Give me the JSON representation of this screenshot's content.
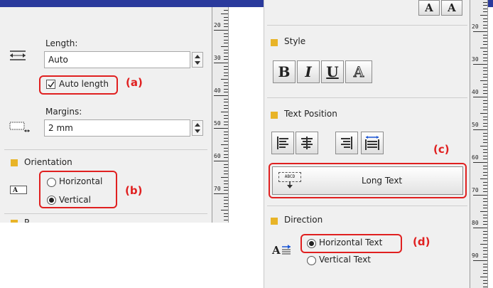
{
  "left_panel": {
    "length_label": "Length:",
    "length_value": "Auto",
    "auto_length_label": "Auto length",
    "auto_length_checked": true,
    "margins_label": "Margins:",
    "margins_value": "2 mm",
    "orientation_title": "Orientation",
    "orientation_options": [
      {
        "label": "Horizontal",
        "selected": false
      },
      {
        "label": "Vertical",
        "selected": true
      }
    ],
    "cut_section_fragment": "P",
    "tags": {
      "a": "(a)",
      "b": "(b)"
    }
  },
  "right_panel": {
    "font_size_buttons": [
      "A",
      "A"
    ],
    "style_title": "Style",
    "style_buttons": [
      "B",
      "I",
      "U",
      "A"
    ],
    "text_position_title": "Text Position",
    "long_text_label": "Long Text",
    "long_text_icon_label": "ABCD",
    "direction_title": "Direction",
    "direction_options": [
      {
        "label": "Horizontal Text",
        "selected": true
      },
      {
        "label": "Vertical Text",
        "selected": false
      }
    ],
    "tags": {
      "c": "(c)",
      "d": "(d)"
    }
  },
  "rulers": {
    "left": [
      "20",
      "30",
      "40",
      "50",
      "60",
      "70"
    ],
    "right": [
      "20",
      "30",
      "40",
      "50",
      "60",
      "70",
      "80",
      "90"
    ]
  },
  "colors": {
    "section_square": "#e8b428",
    "highlight": "#e02020",
    "topbar": "#2a3a9c"
  }
}
